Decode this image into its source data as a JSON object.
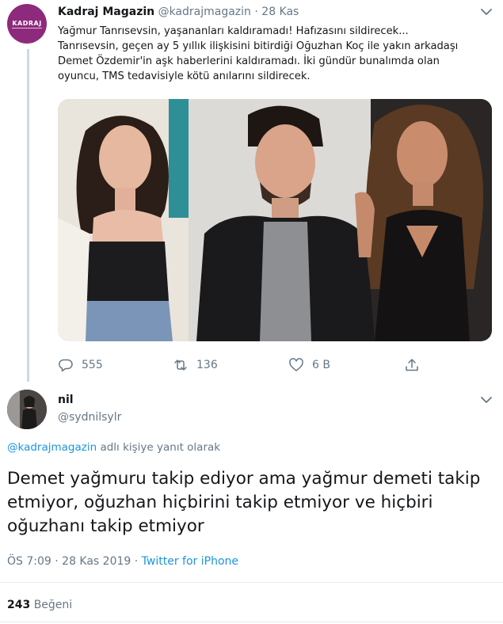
{
  "parent_tweet": {
    "avatar_text": "KADRAJ",
    "display_name": "Kadraj Magazin",
    "handle": "@kadrajmagazin",
    "separator": "·",
    "date": "28 Kas",
    "text_lines": [
      "Yağmur Tanrısevsin, yaşananları kaldıramadı! Hafızasını sildirecek...",
      "Tanrısevsin, geçen ay 5 yıllık ilişkisini bitirdiği Oğuzhan Koç ile yakın arkadaşı",
      "Demet Özdemir'in aşk haberlerini kaldıramadı. İki gündür bunalımda olan",
      "oyuncu, TMS tedavisiyle kötü anılarını sildirecek."
    ],
    "actions": {
      "reply_count": "555",
      "retweet_count": "136",
      "like_count": "6 B"
    },
    "icons": [
      "reply-icon",
      "retweet-icon",
      "like-icon",
      "share-icon",
      "chevron-down-icon"
    ]
  },
  "reply_tweet": {
    "display_name": "nil",
    "handle": "@sydnilsylr",
    "replying_mention": "@kadrajmagazin",
    "replying_suffix": " adlı kişiye yanıt olarak",
    "body_lines": [
      "Demet yağmuru takip ediyor ama yağmur demeti takip",
      "etmiyor, oğuzhan hiçbirini takip etmiyor ve hiçbiri",
      "oğuzhanı takip etmiyor"
    ],
    "time": "ÖS 7:09",
    "separator": "·",
    "date": "28 Kas 2019",
    "source": "Twitter for iPhone",
    "like_count": "243",
    "like_label": "Beğeni"
  },
  "colors": {
    "brand_avatar": "#8e2a7c",
    "link": "#1b95e0",
    "secondary_text": "#657786",
    "primary_text": "#14171a",
    "thread_line": "#cfd9de"
  }
}
